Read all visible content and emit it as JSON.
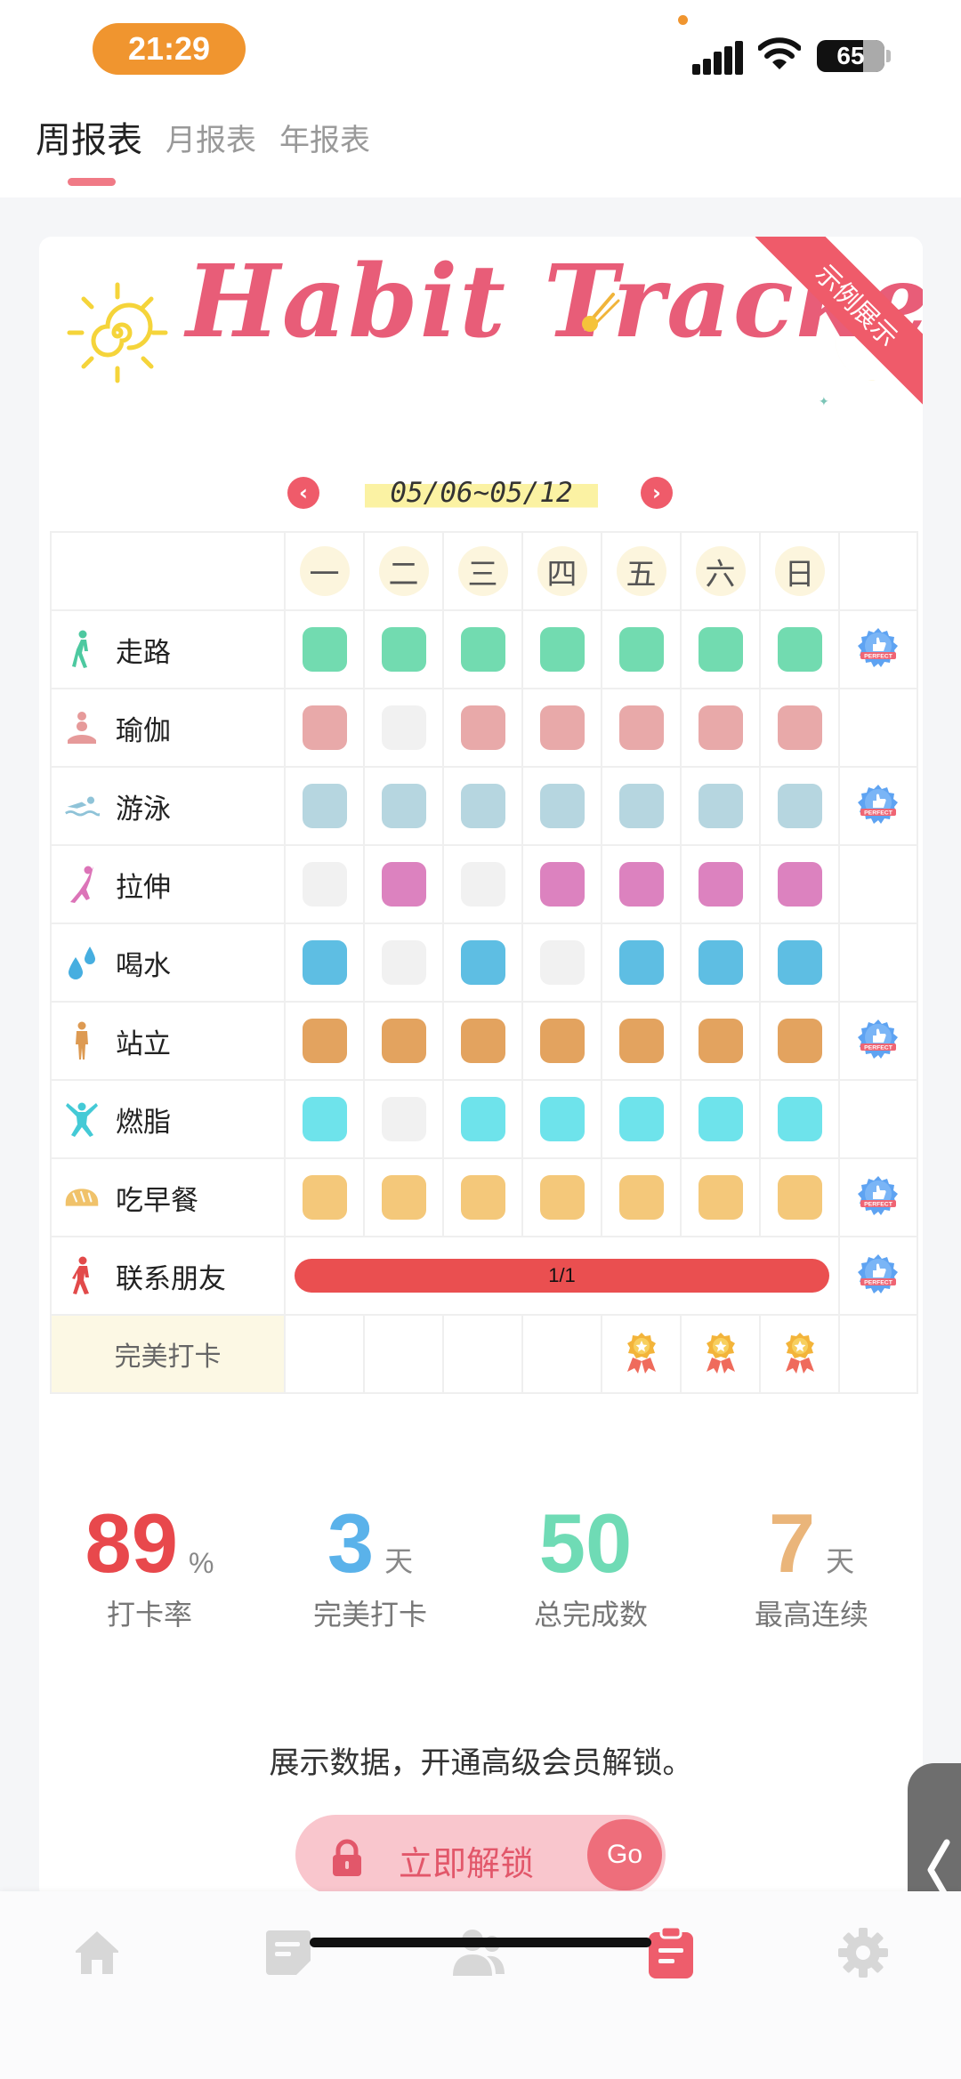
{
  "status_bar": {
    "time": "21:29",
    "battery": "65"
  },
  "tabs": [
    {
      "label": "周报表",
      "active": true
    },
    {
      "label": "月报表",
      "active": false
    },
    {
      "label": "年报表",
      "active": false
    }
  ],
  "card": {
    "ribbon": "示例展示",
    "banner_title": "Habit Tracker",
    "date_range": "05/06~05/12",
    "prev_icon": "chevron-left-icon",
    "next_icon": "chevron-right-icon"
  },
  "days": [
    "一",
    "二",
    "三",
    "四",
    "五",
    "六",
    "日"
  ],
  "colors": {
    "empty": "#f1f1f1",
    "accent": "#ef5b6a"
  },
  "habits": [
    {
      "name": "走路",
      "icon": "walking-icon",
      "color": "#72dbb0",
      "done": [
        1,
        1,
        1,
        1,
        1,
        1,
        1
      ],
      "perfect": true
    },
    {
      "name": "瑜伽",
      "icon": "yoga-icon",
      "color": "#e8a9a9",
      "done": [
        1,
        0,
        1,
        1,
        1,
        1,
        1
      ],
      "perfect": false
    },
    {
      "name": "游泳",
      "icon": "swimming-icon",
      "color": "#b6d6e0",
      "done": [
        1,
        1,
        1,
        1,
        1,
        1,
        1
      ],
      "perfect": true
    },
    {
      "name": "拉伸",
      "icon": "stretching-icon",
      "color": "#dc82bf",
      "done": [
        0,
        1,
        0,
        1,
        1,
        1,
        1
      ],
      "perfect": false
    },
    {
      "name": "喝水",
      "icon": "water-drop-icon",
      "color": "#5ebee3",
      "done": [
        1,
        0,
        1,
        0,
        1,
        1,
        1
      ],
      "perfect": false
    },
    {
      "name": "站立",
      "icon": "standing-icon",
      "color": "#e3a35f",
      "done": [
        1,
        1,
        1,
        1,
        1,
        1,
        1
      ],
      "perfect": true
    },
    {
      "name": "燃脂",
      "icon": "jumping-icon",
      "color": "#6ee3eb",
      "done": [
        1,
        0,
        1,
        1,
        1,
        1,
        1
      ],
      "perfect": false
    },
    {
      "name": "吃早餐",
      "icon": "bread-icon",
      "color": "#f4c87a",
      "done": [
        1,
        1,
        1,
        1,
        1,
        1,
        1
      ],
      "perfect": true
    }
  ],
  "contact_friends": {
    "name": "联系朋友",
    "icon": "running-person-icon",
    "progress_text": "1/1",
    "progress": 1.0,
    "perfect": true
  },
  "perfect_row": {
    "label": "完美打卡",
    "medals": [
      0,
      0,
      0,
      0,
      1,
      1,
      1
    ]
  },
  "badge": {
    "text": "PERFECT",
    "icon": "thumbs-up-badge-icon"
  },
  "stats": [
    {
      "value": "89",
      "unit": "%",
      "label": "打卡率",
      "color": "#e8484c"
    },
    {
      "value": "3",
      "unit": "天",
      "label": "完美打卡",
      "color": "#5ab2ea"
    },
    {
      "value": "50",
      "unit": "",
      "label": "总完成数",
      "color": "#6fdbb5"
    },
    {
      "value": "7",
      "unit": "天",
      "label": "最高连续",
      "color": "#eab57a"
    }
  ],
  "unlock": {
    "text": "展示数据，开通高级会员解锁。",
    "button_label": "立即解锁",
    "go_label": "Go"
  },
  "bottom_nav": [
    {
      "icon": "home-icon",
      "active": false
    },
    {
      "icon": "notes-icon",
      "active": false
    },
    {
      "icon": "friends-icon",
      "active": false
    },
    {
      "icon": "report-clipboard-icon",
      "active": true
    },
    {
      "icon": "gear-icon",
      "active": false
    }
  ]
}
